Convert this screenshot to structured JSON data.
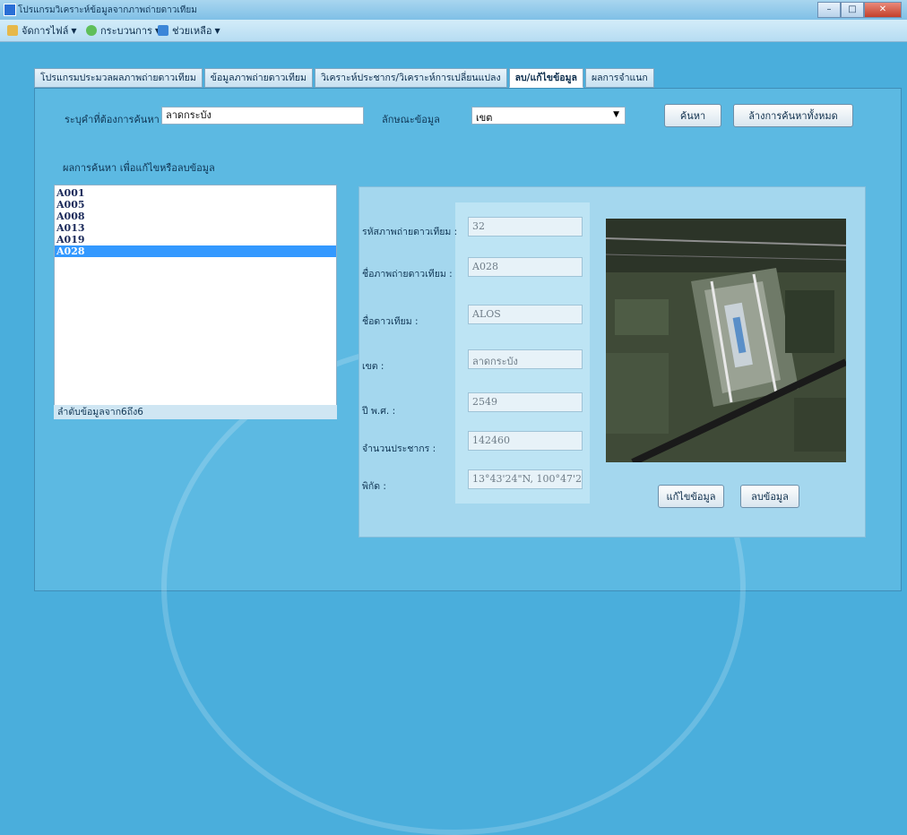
{
  "window": {
    "title": "โปรแกรมวิเคราะห์ข้อมูลจากภาพถ่ายดาวเทียม"
  },
  "menu": [
    {
      "label": "จัดการไฟล์"
    },
    {
      "label": "กระบวนการ"
    },
    {
      "label": "ช่วยเหลือ"
    }
  ],
  "tabs": [
    {
      "label": "โปรแกรมประมวลผลภาพถ่ายดาวเทียม"
    },
    {
      "label": "ข้อมูลภาพถ่ายดาวเทียม"
    },
    {
      "label": "วิเคราะห์ประชากร/วิเคราะห์การเปลี่ยนแปลง"
    },
    {
      "label": "ลบ/แก้ไขข้อมูล"
    },
    {
      "label": "ผลการจำแนก"
    }
  ],
  "search": {
    "keyword_label": "ระบุคำที่ต้องการค้นหา",
    "keyword_value": "ลาดกระบัง",
    "type_label": "ลักษณะข้อมูล",
    "type_value": "เขต",
    "search_button": "ค้นหา",
    "clear_button": "ล้างการค้นหาทั้งหมด",
    "results_heading": "ผลการค้นหา เพื่อแก้ไขหรือลบข้อมูล"
  },
  "results": {
    "items": [
      "A001",
      "A005",
      "A008",
      "A013",
      "A019",
      "A028"
    ],
    "selected": "A028",
    "status": "ลำดับข้อมูลจาก6ถึง6"
  },
  "detail": {
    "fields": [
      {
        "label": "รหัสภาพถ่ายดาวเทียม :",
        "value": "32"
      },
      {
        "label": "ชื่อภาพถ่ายดาวเทียม :",
        "value": "A028"
      },
      {
        "label": "ชื่อดาวเทียม :",
        "value": "ALOS"
      },
      {
        "label": "เขต :",
        "value": "ลาดกระบัง"
      },
      {
        "label": "ปี พ.ศ. :",
        "value": "2549"
      },
      {
        "label": "จำนวนประชากร :",
        "value": "142460"
      },
      {
        "label": "พิกัด :",
        "value": "13°43'24\"N, 100°47'2"
      }
    ],
    "edit_button": "แก้ไขข้อมูล",
    "delete_button": "ลบข้อมูล"
  }
}
